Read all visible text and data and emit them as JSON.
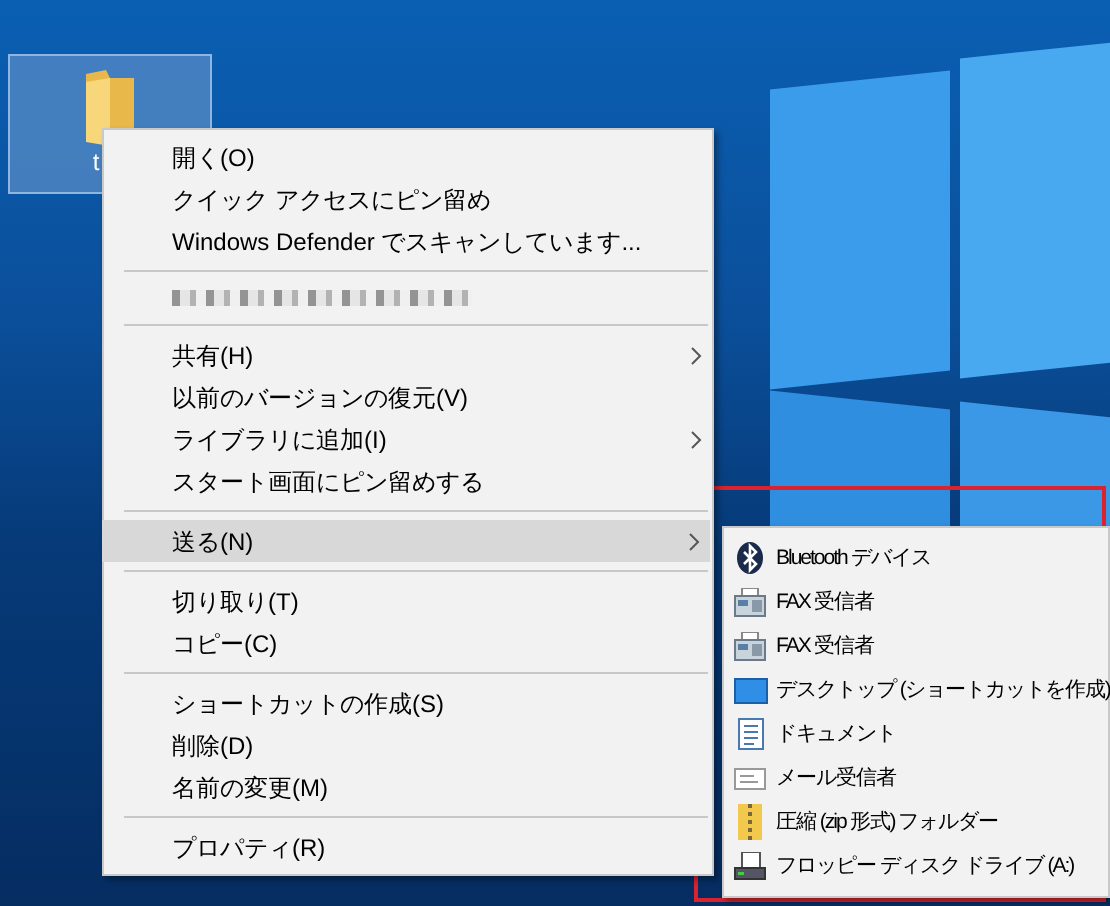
{
  "desktop": {
    "icons": [
      {
        "label": "t",
        "selected": true
      }
    ]
  },
  "context_menu": {
    "items": [
      {
        "kind": "item",
        "label": "開く(O)",
        "has_submenu": false,
        "selected": false
      },
      {
        "kind": "item",
        "label": "クイック アクセスにピン留め",
        "has_submenu": false,
        "selected": false
      },
      {
        "kind": "item",
        "label": "Windows Defender でスキャンしています...",
        "has_submenu": false,
        "selected": false
      },
      {
        "kind": "separator"
      },
      {
        "kind": "redacted"
      },
      {
        "kind": "separator"
      },
      {
        "kind": "item",
        "label": "共有(H)",
        "has_submenu": true,
        "selected": false
      },
      {
        "kind": "item",
        "label": "以前のバージョンの復元(V)",
        "has_submenu": false,
        "selected": false
      },
      {
        "kind": "item",
        "label": "ライブラリに追加(I)",
        "has_submenu": true,
        "selected": false
      },
      {
        "kind": "item",
        "label": "スタート画面にピン留めする",
        "has_submenu": false,
        "selected": false
      },
      {
        "kind": "separator"
      },
      {
        "kind": "item",
        "label": "送る(N)",
        "has_submenu": true,
        "selected": true
      },
      {
        "kind": "separator"
      },
      {
        "kind": "item",
        "label": "切り取り(T)",
        "has_submenu": false,
        "selected": false
      },
      {
        "kind": "item",
        "label": "コピー(C)",
        "has_submenu": false,
        "selected": false
      },
      {
        "kind": "separator"
      },
      {
        "kind": "item",
        "label": "ショートカットの作成(S)",
        "has_submenu": false,
        "selected": false
      },
      {
        "kind": "item",
        "label": "削除(D)",
        "has_submenu": false,
        "selected": false
      },
      {
        "kind": "item",
        "label": "名前の変更(M)",
        "has_submenu": false,
        "selected": false
      },
      {
        "kind": "separator"
      },
      {
        "kind": "item",
        "label": "プロパティ(R)",
        "has_submenu": false,
        "selected": false
      }
    ]
  },
  "send_to_submenu": {
    "items": [
      {
        "kind": "bluetooth",
        "label": "Bluetooth デバイス"
      },
      {
        "kind": "fax",
        "label": "FAX 受信者"
      },
      {
        "kind": "fax",
        "label": "FAX 受信者"
      },
      {
        "kind": "desktop",
        "label": "デスクトップ (ショートカットを作成)"
      },
      {
        "kind": "document",
        "label": "ドキュメント"
      },
      {
        "kind": "mail",
        "label": "メール受信者"
      },
      {
        "kind": "zip",
        "label": "圧縮 (zip 形式) フォルダー"
      },
      {
        "kind": "floppy",
        "label": "フロッピー ディスク ドライブ (A:)"
      }
    ]
  }
}
